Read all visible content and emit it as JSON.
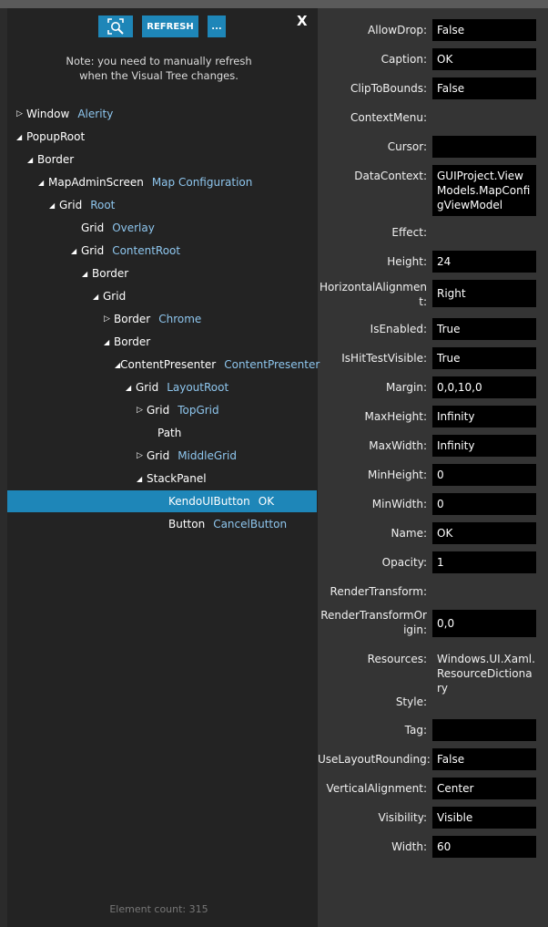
{
  "toolbar": {
    "refresh_label": "REFRESH",
    "more_label": "...",
    "close_label": "X"
  },
  "note": {
    "line1": "Note: you need to manually refresh",
    "line2": "when the Visual Tree changes."
  },
  "tree": [
    {
      "type": "Window",
      "name": "Alerity",
      "toggle": "collapsed"
    },
    {
      "type": "PopupRoot",
      "name": "",
      "toggle": "expanded"
    },
    {
      "type": "Border",
      "name": "",
      "toggle": "expanded"
    },
    {
      "type": "MapAdminScreen",
      "name": "Map Configuration",
      "toggle": "expanded"
    },
    {
      "type": "Grid",
      "name": "Root",
      "toggle": "expanded"
    },
    {
      "type": "Grid",
      "name": "Overlay",
      "toggle": "none"
    },
    {
      "type": "Grid",
      "name": "ContentRoot",
      "toggle": "expanded"
    },
    {
      "type": "Border",
      "name": "",
      "toggle": "expanded"
    },
    {
      "type": "Grid",
      "name": "",
      "toggle": "expanded"
    },
    {
      "type": "Border",
      "name": "Chrome",
      "toggle": "collapsed"
    },
    {
      "type": "Border",
      "name": "",
      "toggle": "expanded"
    },
    {
      "type": "ContentPresenter",
      "name": "ContentPresenter",
      "toggle": "expanded"
    },
    {
      "type": "Grid",
      "name": "LayoutRoot",
      "toggle": "expanded"
    },
    {
      "type": "Grid",
      "name": "TopGrid",
      "toggle": "collapsed"
    },
    {
      "type": "Path",
      "name": "",
      "toggle": "none"
    },
    {
      "type": "Grid",
      "name": "MiddleGrid",
      "toggle": "collapsed"
    },
    {
      "type": "StackPanel",
      "name": "",
      "toggle": "expanded"
    },
    {
      "type": "KendoUIButton",
      "name": "OK",
      "toggle": "none",
      "selected": true
    },
    {
      "type": "Button",
      "name": "CancelButton",
      "toggle": "none"
    }
  ],
  "element_count": "Element count: 315",
  "properties": [
    {
      "label": "AllowDrop:",
      "value": "False",
      "box": true
    },
    {
      "label": "Caption:",
      "value": "OK",
      "box": true
    },
    {
      "label": "ClipToBounds:",
      "value": "False",
      "box": true
    },
    {
      "label": "ContextMenu:",
      "value": "",
      "box": false
    },
    {
      "label": "Cursor:",
      "value": "",
      "box": true
    },
    {
      "label": "DataContext:",
      "value": "GUIProject.ViewModels.MapConfigViewModel",
      "box": true
    },
    {
      "label": "Effect:",
      "value": "",
      "box": false
    },
    {
      "label": "Height:",
      "value": "24",
      "box": true
    },
    {
      "label": "HorizontalAlignment:",
      "value": "Right",
      "box": true
    },
    {
      "label": "IsEnabled:",
      "value": "True",
      "box": true
    },
    {
      "label": "IsHitTestVisible:",
      "value": "True",
      "box": true
    },
    {
      "label": "Margin:",
      "value": "0,0,10,0",
      "box": true
    },
    {
      "label": "MaxHeight:",
      "value": "Infinity",
      "box": true
    },
    {
      "label": "MaxWidth:",
      "value": "Infinity",
      "box": true
    },
    {
      "label": "MinHeight:",
      "value": "0",
      "box": true
    },
    {
      "label": "MinWidth:",
      "value": "0",
      "box": true
    },
    {
      "label": "Name:",
      "value": "OK",
      "box": true
    },
    {
      "label": "Opacity:",
      "value": "1",
      "box": true
    },
    {
      "label": "RenderTransform:",
      "value": "",
      "box": false
    },
    {
      "label": "RenderTransformOrigin:",
      "value": "0,0",
      "box": true
    },
    {
      "label": "Resources:",
      "value": "Windows.UI.Xaml.ResourceDictionary",
      "box": false
    },
    {
      "label": "Style:",
      "value": "",
      "box": false
    },
    {
      "label": "Tag:",
      "value": "",
      "box": true
    },
    {
      "label": "UseLayoutRounding:",
      "value": "False",
      "box": true
    },
    {
      "label": "VerticalAlignment:",
      "value": "Center",
      "box": true
    },
    {
      "label": "Visibility:",
      "value": "Visible",
      "box": true
    },
    {
      "label": "Width:",
      "value": "60",
      "box": true
    }
  ],
  "colors": {
    "accent": "#1e86b8",
    "panel_left": "#232323",
    "panel_right": "#343434",
    "element_name": "#8ec6ee"
  }
}
